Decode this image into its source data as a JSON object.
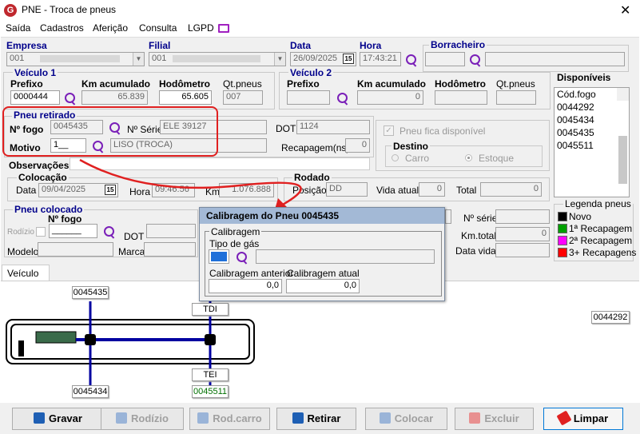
{
  "window": {
    "title": "PNE - Troca de pneus",
    "close": "✕",
    "logo": "G"
  },
  "menu": [
    "Saída",
    "Cadastros",
    "Aferição",
    "Consulta",
    "LGPD"
  ],
  "header": {
    "empresa_label": "Empresa",
    "empresa_value": "001",
    "filial_label": "Filial",
    "filial_value": "001",
    "data_label": "Data",
    "data_value": "26/09/2025",
    "hora_label": "Hora",
    "hora_value": "17:43:21",
    "borracheiro_label": "Borracheiro",
    "cal_icon": "15"
  },
  "veiculo1": {
    "title": "Veículo 1",
    "prefixo_label": "Prefixo",
    "prefixo": "0000444",
    "km_label": "Km acumulado",
    "km": "65.839",
    "hod_label": "Hodômetro",
    "hod": "65.605",
    "qt_label": "Qt.pneus",
    "qt": "007"
  },
  "veiculo2": {
    "title": "Veículo 2",
    "prefixo_label": "Prefixo",
    "km_label": "Km acumulado",
    "km": "0",
    "hod_label": "Hodômetro",
    "qt_label": "Qt.pneus"
  },
  "disponiveis": {
    "title": "Disponíveis",
    "items": [
      "Cód.fogo",
      "0044292",
      "0045434",
      "0045435",
      "0045511"
    ]
  },
  "retirado": {
    "title": "Pneu retirado",
    "fogo_label": "Nº fogo",
    "fogo": "0045435",
    "serie_label": "Nº Série",
    "serie": "ELE 39127",
    "dot_label": "DOT",
    "dot": "1124",
    "motivo_label": "Motivo",
    "motivo_code": "1__",
    "motivo_desc": "LISO (TROCA)",
    "recap_label": "Recapagem(ns)",
    "recap": "0",
    "fica_label": "Pneu fica disponível",
    "destino_label": "Destino",
    "carro_label": "Carro",
    "estoque_label": "Estoque",
    "obs_label": "Observações"
  },
  "colocacao": {
    "title": "Colocação",
    "data_label": "Data",
    "data": "09/04/2025",
    "hora_label": "Hora",
    "hora": "09:46:56",
    "km_label": "Km",
    "km": "1.076.888"
  },
  "rodado": {
    "title": "Rodado",
    "posicao_label": "Posição",
    "posicao": "DD",
    "vida_label": "Vida atual",
    "vida": "0",
    "total_label": "Total",
    "total": "0"
  },
  "colocado": {
    "title": "Pneu colocado",
    "fogo_label": "Nº fogo",
    "fogo": "______",
    "rodizio_label": "Rodízio",
    "dot_label": "DOT",
    "modelo_label": "Modelo",
    "marca_label": "Marca",
    "serie_label": "Nº série",
    "kmtotal_label": "Km.total",
    "kmtotal": "0",
    "datavida_label": "Data vida"
  },
  "legenda": {
    "title": "Legenda pneus",
    "items": [
      {
        "label": "Novo",
        "color": "#000000"
      },
      {
        "label": "1ª Recapagem",
        "color": "#00a000"
      },
      {
        "label": "2ª Recapagem",
        "color": "#ff00ff"
      },
      {
        "label": "3+ Recapagens",
        "color": "#ff0000"
      }
    ]
  },
  "popup": {
    "title": "Calibragem do Pneu 0045435",
    "group": "Calibragem",
    "tipo_label": "Tipo de gás",
    "anterior_label": "Calibragem anterior",
    "anterior": "0,0",
    "atual_label": "Calibragem atual",
    "atual": "0,0",
    "gas_color": "#1e6fd9"
  },
  "tabs": {
    "veiculo1": "Veículo 1"
  },
  "diagram": {
    "tire_top_left": "0045435",
    "tire_top_right": "TDI",
    "tire_right": "0044292",
    "tire_bottom_left": "0045434",
    "tire_bottom_right_pos": "TEI",
    "tire_bottom_right": "0045511"
  },
  "buttons": {
    "gravar": "Gravar",
    "rodizio": "Rodízio",
    "rodcarro": "Rod.carro",
    "retirar": "Retirar",
    "colocar": "Colocar",
    "excluir": "Excluir",
    "limpar": "Limpar"
  }
}
